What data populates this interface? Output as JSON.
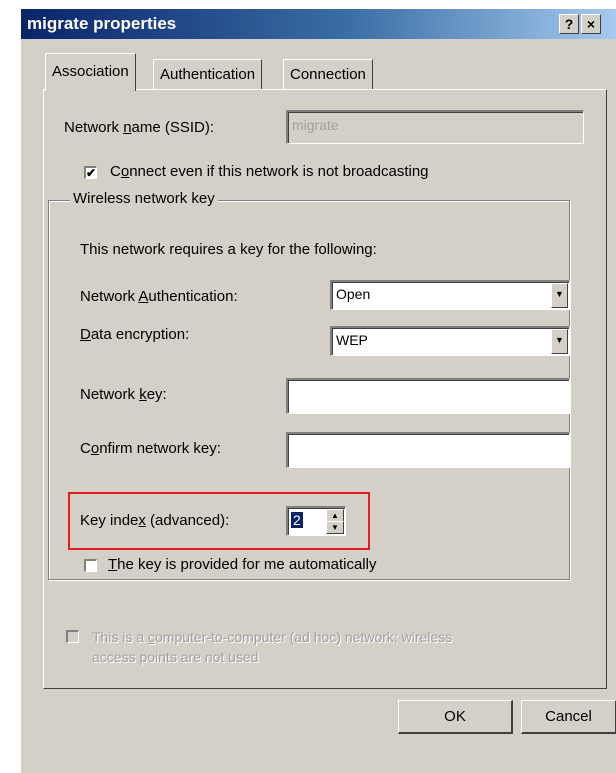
{
  "window": {
    "title": "migrate properties",
    "help_label": "?",
    "close_label": "×"
  },
  "tabs": [
    {
      "label": "Association",
      "active": true
    },
    {
      "label": "Authentication",
      "active": false
    },
    {
      "label": "Connection",
      "active": false
    }
  ],
  "association": {
    "ssid_label_pre": "Network ",
    "ssid_label_key": "n",
    "ssid_label_post": "ame (SSID):",
    "ssid_value": "migrate",
    "broadcast_label_pre": "C",
    "broadcast_label_key": "o",
    "broadcast_label_post": "nnect even if this network is not broadcasting",
    "broadcast_checked": "✔"
  },
  "wireless_key": {
    "group_label": "Wireless network key",
    "intro": "This network requires a key for the following:",
    "auth_label_pre": "Network ",
    "auth_label_key": "A",
    "auth_label_post": "uthentication:",
    "auth_value": "Open",
    "enc_label_key": "D",
    "enc_label_post": "ata encryption:",
    "enc_value": "WEP",
    "netkey_label_pre": "Network ",
    "netkey_label_key": "k",
    "netkey_label_post": "ey:",
    "netkey_value": "",
    "confirm_label_pre": "C",
    "confirm_label_key": "o",
    "confirm_label_post": "nfirm network key:",
    "confirm_value": "",
    "keyindex_label_pre": "Key inde",
    "keyindex_label_key": "x",
    "keyindex_label_post": " (advanced):",
    "keyindex_value": "2",
    "auto_label_key": "T",
    "auto_label_post": "he key is provided for me automatically"
  },
  "adhoc": {
    "label_line1_pre": "This is a ",
    "label_line1_key": "c",
    "label_line1_post": "omputer-to-computer (ad hoc) network; wireless",
    "label_line2": "access points are not used"
  },
  "buttons": {
    "ok": "OK",
    "cancel": "Cancel"
  },
  "colors": {
    "dialog_bg": "#d4d0c8",
    "title_start": "#0a246a",
    "title_end": "#a6caf0",
    "highlight": "#e02020"
  }
}
